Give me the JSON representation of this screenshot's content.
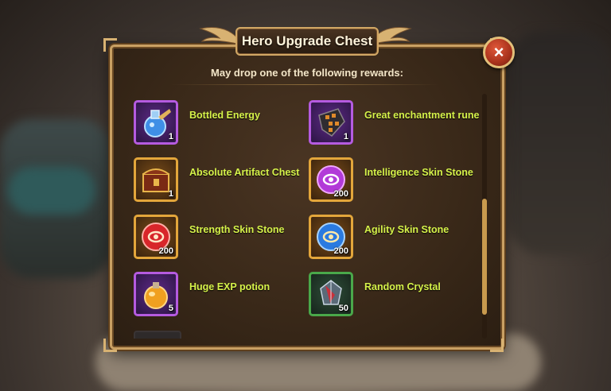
{
  "dialog": {
    "title": "Hero Upgrade Chest",
    "subtitle": "May drop one of the following rewards:",
    "close_icon": "×"
  },
  "rewards": [
    {
      "name": "Bottled Energy",
      "qty": "1",
      "frame": "purple",
      "icon": "bottled-energy-icon"
    },
    {
      "name": "Great enchantment rune",
      "qty": "1",
      "frame": "purple",
      "icon": "enchantment-rune-icon"
    },
    {
      "name": "Absolute Artifact Chest",
      "qty": "1",
      "frame": "gold",
      "icon": "artifact-chest-icon"
    },
    {
      "name": "Intelligence Skin Stone",
      "qty": "200",
      "frame": "gold",
      "icon": "intelligence-stone-icon"
    },
    {
      "name": "Strength Skin Stone",
      "qty": "200",
      "frame": "gold",
      "icon": "strength-stone-icon"
    },
    {
      "name": "Agility Skin Stone",
      "qty": "200",
      "frame": "gold",
      "icon": "agility-stone-icon"
    },
    {
      "name": "Huge EXP potion",
      "qty": "5",
      "frame": "purple",
      "icon": "exp-potion-icon"
    },
    {
      "name": "Random Crystal",
      "qty": "50",
      "frame": "green",
      "icon": "crystal-icon"
    }
  ],
  "colors": {
    "label": "#d6f24a",
    "frame_purple": "#b55be0",
    "frame_gold": "#e3a63b",
    "frame_green": "#4aa84a",
    "border": "#c9a063"
  }
}
